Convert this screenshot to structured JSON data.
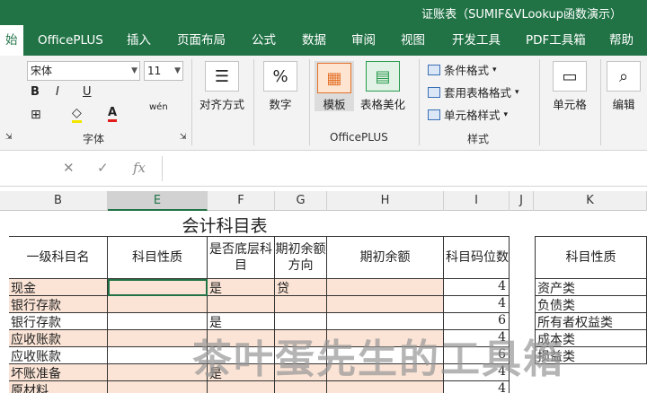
{
  "window": {
    "title": "证账表（SUMIF&VLookup函数演示）"
  },
  "tabs": [
    {
      "label": "始",
      "active": true
    },
    {
      "label": "OfficePLUS"
    },
    {
      "label": "插入"
    },
    {
      "label": "页面布局"
    },
    {
      "label": "公式"
    },
    {
      "label": "数据"
    },
    {
      "label": "审阅"
    },
    {
      "label": "视图"
    },
    {
      "label": "开发工具"
    },
    {
      "label": "PDF工具箱"
    },
    {
      "label": "帮助"
    }
  ],
  "ribbon": {
    "font_name": "宋体",
    "font_size": "11",
    "bold": "B",
    "italic": "I",
    "underline": "U",
    "font_color_letter": "A",
    "phonetic": "wén",
    "font_group": "字体",
    "align_label": "对齐方式",
    "number_label": "数字",
    "number_icon": "%",
    "template_label": "模板",
    "beautify_label": "表格美化",
    "officeplus_group": "OfficePLUS",
    "cond_format": "条件格式",
    "table_format": "套用表格格式",
    "cell_style": "单元格样式",
    "style_group": "样式",
    "cells_label": "单元格",
    "edit_label": "编辑"
  },
  "formula_bar": {
    "cancel": "✕",
    "enter": "✓",
    "fx": "fx",
    "value": ""
  },
  "columns": [
    "B",
    "E",
    "F",
    "G",
    "H",
    "I",
    "J",
    "K"
  ],
  "sheet": {
    "title": "会计科目表",
    "headers": {
      "b": "一级科目名",
      "e": "科目性质",
      "f": "是否底层科目",
      "g": "期初余额方向",
      "h": "期初余额",
      "i": "科目码位数",
      "k": "科目性质"
    },
    "rows": [
      {
        "b": "现金",
        "f": "是",
        "g": "贷",
        "i": "4"
      },
      {
        "b": "银行存款",
        "f": "",
        "g": "",
        "i": "4"
      },
      {
        "b": "银行存款",
        "f": "是",
        "g": "",
        "i": "6"
      },
      {
        "b": "应收账款",
        "f": "",
        "g": "",
        "i": "4"
      },
      {
        "b": "应收账款",
        "f": "",
        "g": "",
        "i": "6"
      },
      {
        "b": "坏账准备",
        "f": "是",
        "g": "",
        "i": "4"
      },
      {
        "b": "原材料",
        "f": "",
        "g": "",
        "i": "4"
      }
    ],
    "k_list": [
      "资产类",
      "负债类",
      "所有者权益类",
      "成本类",
      "损益类"
    ]
  },
  "watermark": "茶叶蛋先生的工具箱",
  "colors": {
    "accent": "#217346",
    "peach": "#fbe4d5"
  }
}
